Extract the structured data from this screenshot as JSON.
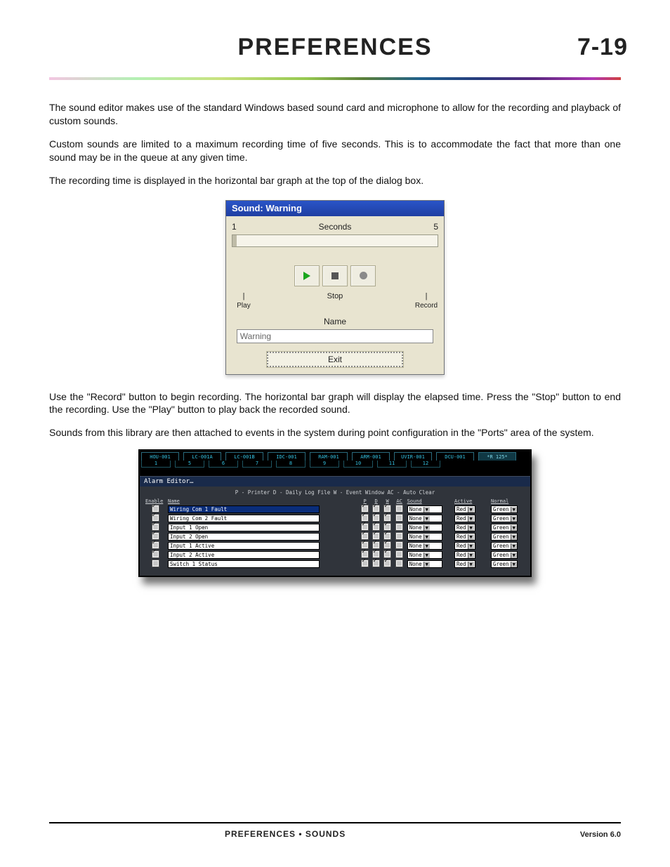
{
  "header": {
    "title": "PREFERENCES",
    "page": "7-19"
  },
  "paragraphs": {
    "p1": "The sound editor makes use of the standard Windows based sound card and microphone to allow for the recording and playback of custom sounds.",
    "p2": "Custom sounds are limited to a maximum recording time of five seconds.  This is to accommodate the fact that more than one sound may be in the queue at any given time.",
    "p3": "The recording time is displayed in the horizontal bar graph at the top of the dialog box.",
    "p4": "Use the \"Record\" button to begin recording.  The horizontal bar graph will display the elapsed time.  Press the \"Stop\" button to end the recording.  Use the \"Play\" button to play back the recorded sound.",
    "p5": "Sounds from this library are then attached to events in the system during point configuration in the \"Ports\" area of the system."
  },
  "dialog": {
    "title": "Sound: Warning",
    "seconds_label": "Seconds",
    "seconds_min": "1",
    "seconds_max": "5",
    "play": "Play",
    "stop": "Stop",
    "record": "Record",
    "name_label": "Name",
    "name_value": "Warning",
    "exit": "Exit"
  },
  "alarm": {
    "tabs": [
      {
        "label": "HOU-001",
        "num": "1"
      },
      {
        "label": "LC-001A",
        "num": "5"
      },
      {
        "label": "LC-001B",
        "num": "6"
      },
      {
        "label": "IDC-001",
        "num": "7"
      },
      {
        "label": "RAM-001",
        "num": "8"
      },
      {
        "label": "ARM-001",
        "num": "9"
      },
      {
        "label": "UVIR-001",
        "num": "10"
      },
      {
        "label": "DCU-001",
        "num": "11"
      },
      {
        "label": "*R 125*",
        "num": "12",
        "active": true
      }
    ],
    "title": "Alarm Editor…",
    "legend": "P - Printer D - Daily Log File W - Event Window AC - Auto Clear",
    "headers": {
      "enable": "Enable",
      "name": "Name",
      "p": "P",
      "d": "D",
      "w": "W",
      "ac": "AC",
      "sound": "Sound",
      "active": "Active",
      "normal": "Normal"
    },
    "rows": [
      {
        "enable": true,
        "name": "Wiring Com 1 Fault",
        "selected": true,
        "p": true,
        "d": true,
        "w": true,
        "ac": false,
        "sound": "None",
        "active": "Red",
        "normal": "Green"
      },
      {
        "enable": true,
        "name": "Wiring Com 2 Fault",
        "selected": false,
        "p": true,
        "d": true,
        "w": true,
        "ac": false,
        "sound": "None",
        "active": "Red",
        "normal": "Green"
      },
      {
        "enable": true,
        "name": "Input 1 Open",
        "selected": false,
        "p": true,
        "d": true,
        "w": true,
        "ac": false,
        "sound": "None",
        "active": "Red",
        "normal": "Green"
      },
      {
        "enable": true,
        "name": "Input 2 Open",
        "selected": false,
        "p": true,
        "d": true,
        "w": true,
        "ac": false,
        "sound": "None",
        "active": "Red",
        "normal": "Green"
      },
      {
        "enable": true,
        "name": "Input 1 Active",
        "selected": false,
        "p": true,
        "d": true,
        "w": true,
        "ac": false,
        "sound": "None",
        "active": "Red",
        "normal": "Green"
      },
      {
        "enable": true,
        "name": "Input 2 Active",
        "selected": false,
        "p": true,
        "d": true,
        "w": true,
        "ac": false,
        "sound": "None",
        "active": "Red",
        "normal": "Green"
      },
      {
        "enable": false,
        "name": "Switch 1 Status",
        "selected": false,
        "p": true,
        "d": true,
        "w": true,
        "ac": false,
        "sound": "None",
        "active": "Red",
        "normal": "Green"
      }
    ]
  },
  "footer": {
    "left": "PREFERENCES • SOUNDS",
    "right": "Version 6.0"
  }
}
